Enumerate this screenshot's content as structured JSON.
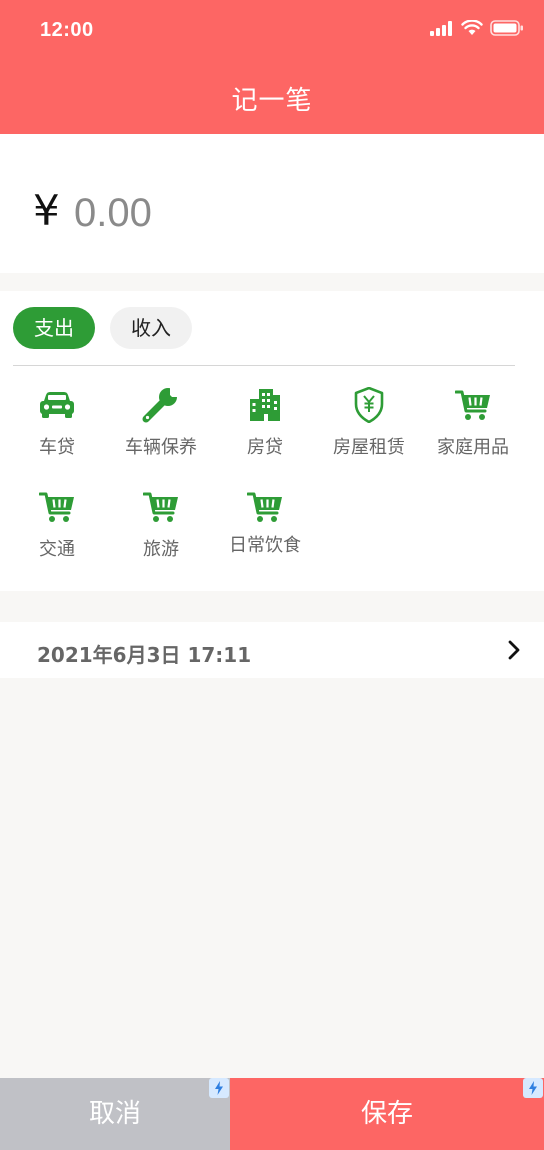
{
  "status_bar": {
    "time": "12:00"
  },
  "header": {
    "title": "记一笔"
  },
  "amount": {
    "currency_symbol": "¥",
    "placeholder": "0.00"
  },
  "type_tabs": [
    {
      "label": "支出",
      "active": true
    },
    {
      "label": "收入",
      "active": false
    }
  ],
  "categories": [
    {
      "label": "车贷",
      "icon": "car-icon"
    },
    {
      "label": "车辆保养",
      "icon": "wrench-icon"
    },
    {
      "label": "房贷",
      "icon": "building-icon"
    },
    {
      "label": "房屋租赁",
      "icon": "shield-yen-icon"
    },
    {
      "label": "家庭用品",
      "icon": "cart-icon"
    },
    {
      "label": "交通",
      "icon": "cart-icon"
    },
    {
      "label": "旅游",
      "icon": "cart-icon"
    },
    {
      "label": "日常饮食",
      "icon": "cart-icon"
    }
  ],
  "date_row": {
    "value": "2021年6月3日 17:11",
    "icon": "chevron-right-icon"
  },
  "footer": {
    "cancel_label": "取消",
    "save_label": "保存",
    "badge_icon": "lightning-icon"
  },
  "colors": {
    "accent": "#fd6664",
    "green": "#2e9c36",
    "cancel_gray": "#c0c1c6"
  }
}
